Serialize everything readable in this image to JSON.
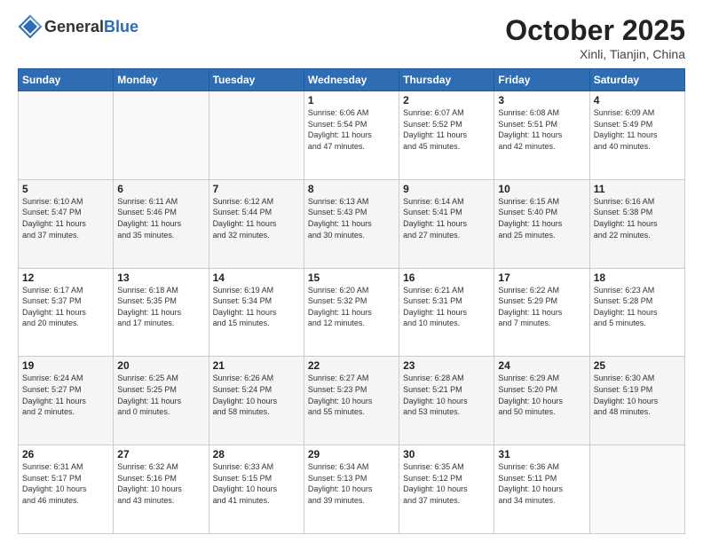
{
  "header": {
    "logo_general": "General",
    "logo_blue": "Blue",
    "title": "October 2025",
    "subtitle": "Xinli, Tianjin, China"
  },
  "weekdays": [
    "Sunday",
    "Monday",
    "Tuesday",
    "Wednesday",
    "Thursday",
    "Friday",
    "Saturday"
  ],
  "weeks": [
    [
      {
        "day": "",
        "info": ""
      },
      {
        "day": "",
        "info": ""
      },
      {
        "day": "",
        "info": ""
      },
      {
        "day": "1",
        "info": "Sunrise: 6:06 AM\nSunset: 5:54 PM\nDaylight: 11 hours\nand 47 minutes."
      },
      {
        "day": "2",
        "info": "Sunrise: 6:07 AM\nSunset: 5:52 PM\nDaylight: 11 hours\nand 45 minutes."
      },
      {
        "day": "3",
        "info": "Sunrise: 6:08 AM\nSunset: 5:51 PM\nDaylight: 11 hours\nand 42 minutes."
      },
      {
        "day": "4",
        "info": "Sunrise: 6:09 AM\nSunset: 5:49 PM\nDaylight: 11 hours\nand 40 minutes."
      }
    ],
    [
      {
        "day": "5",
        "info": "Sunrise: 6:10 AM\nSunset: 5:47 PM\nDaylight: 11 hours\nand 37 minutes."
      },
      {
        "day": "6",
        "info": "Sunrise: 6:11 AM\nSunset: 5:46 PM\nDaylight: 11 hours\nand 35 minutes."
      },
      {
        "day": "7",
        "info": "Sunrise: 6:12 AM\nSunset: 5:44 PM\nDaylight: 11 hours\nand 32 minutes."
      },
      {
        "day": "8",
        "info": "Sunrise: 6:13 AM\nSunset: 5:43 PM\nDaylight: 11 hours\nand 30 minutes."
      },
      {
        "day": "9",
        "info": "Sunrise: 6:14 AM\nSunset: 5:41 PM\nDaylight: 11 hours\nand 27 minutes."
      },
      {
        "day": "10",
        "info": "Sunrise: 6:15 AM\nSunset: 5:40 PM\nDaylight: 11 hours\nand 25 minutes."
      },
      {
        "day": "11",
        "info": "Sunrise: 6:16 AM\nSunset: 5:38 PM\nDaylight: 11 hours\nand 22 minutes."
      }
    ],
    [
      {
        "day": "12",
        "info": "Sunrise: 6:17 AM\nSunset: 5:37 PM\nDaylight: 11 hours\nand 20 minutes."
      },
      {
        "day": "13",
        "info": "Sunrise: 6:18 AM\nSunset: 5:35 PM\nDaylight: 11 hours\nand 17 minutes."
      },
      {
        "day": "14",
        "info": "Sunrise: 6:19 AM\nSunset: 5:34 PM\nDaylight: 11 hours\nand 15 minutes."
      },
      {
        "day": "15",
        "info": "Sunrise: 6:20 AM\nSunset: 5:32 PM\nDaylight: 11 hours\nand 12 minutes."
      },
      {
        "day": "16",
        "info": "Sunrise: 6:21 AM\nSunset: 5:31 PM\nDaylight: 11 hours\nand 10 minutes."
      },
      {
        "day": "17",
        "info": "Sunrise: 6:22 AM\nSunset: 5:29 PM\nDaylight: 11 hours\nand 7 minutes."
      },
      {
        "day": "18",
        "info": "Sunrise: 6:23 AM\nSunset: 5:28 PM\nDaylight: 11 hours\nand 5 minutes."
      }
    ],
    [
      {
        "day": "19",
        "info": "Sunrise: 6:24 AM\nSunset: 5:27 PM\nDaylight: 11 hours\nand 2 minutes."
      },
      {
        "day": "20",
        "info": "Sunrise: 6:25 AM\nSunset: 5:25 PM\nDaylight: 11 hours\nand 0 minutes."
      },
      {
        "day": "21",
        "info": "Sunrise: 6:26 AM\nSunset: 5:24 PM\nDaylight: 10 hours\nand 58 minutes."
      },
      {
        "day": "22",
        "info": "Sunrise: 6:27 AM\nSunset: 5:23 PM\nDaylight: 10 hours\nand 55 minutes."
      },
      {
        "day": "23",
        "info": "Sunrise: 6:28 AM\nSunset: 5:21 PM\nDaylight: 10 hours\nand 53 minutes."
      },
      {
        "day": "24",
        "info": "Sunrise: 6:29 AM\nSunset: 5:20 PM\nDaylight: 10 hours\nand 50 minutes."
      },
      {
        "day": "25",
        "info": "Sunrise: 6:30 AM\nSunset: 5:19 PM\nDaylight: 10 hours\nand 48 minutes."
      }
    ],
    [
      {
        "day": "26",
        "info": "Sunrise: 6:31 AM\nSunset: 5:17 PM\nDaylight: 10 hours\nand 46 minutes."
      },
      {
        "day": "27",
        "info": "Sunrise: 6:32 AM\nSunset: 5:16 PM\nDaylight: 10 hours\nand 43 minutes."
      },
      {
        "day": "28",
        "info": "Sunrise: 6:33 AM\nSunset: 5:15 PM\nDaylight: 10 hours\nand 41 minutes."
      },
      {
        "day": "29",
        "info": "Sunrise: 6:34 AM\nSunset: 5:13 PM\nDaylight: 10 hours\nand 39 minutes."
      },
      {
        "day": "30",
        "info": "Sunrise: 6:35 AM\nSunset: 5:12 PM\nDaylight: 10 hours\nand 37 minutes."
      },
      {
        "day": "31",
        "info": "Sunrise: 6:36 AM\nSunset: 5:11 PM\nDaylight: 10 hours\nand 34 minutes."
      },
      {
        "day": "",
        "info": ""
      }
    ]
  ]
}
